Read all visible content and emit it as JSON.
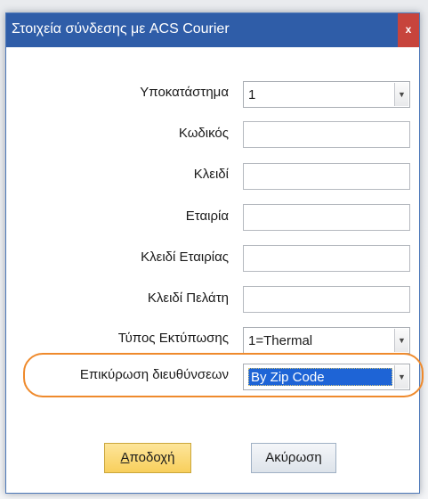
{
  "window": {
    "title": "Στοιχεία σύνδεσης με ACS Courier",
    "close_glyph": "x"
  },
  "form": {
    "branch": {
      "label": "Υποκατάστημα",
      "value": "1"
    },
    "code": {
      "label": "Κωδικός",
      "value": ""
    },
    "key": {
      "label": "Κλειδί",
      "value": ""
    },
    "company": {
      "label": "Εταιρία",
      "value": ""
    },
    "company_key": {
      "label": "Κλειδί Εταιρίας",
      "value": ""
    },
    "customer_key": {
      "label": "Κλειδί Πελάτη",
      "value": ""
    },
    "print_type": {
      "label": "Τύπος Εκτύπωσης",
      "value": "1=Thermal"
    },
    "address_validation": {
      "label": "Επικύρωση διευθύνσεων",
      "value": "By Zip Code"
    }
  },
  "buttons": {
    "accept_label": "Αποδοχή",
    "accept_mnemonic": "Α",
    "accept_rest": "ποδοχή",
    "cancel_label": "Ακύρωση"
  },
  "colors": {
    "titlebar": "#2f5da8",
    "close": "#c7443c",
    "highlight_ring": "#ef8a2c",
    "selection": "#1e64d6",
    "accept_button": "#f8cf5c"
  },
  "icons": {
    "dropdown": "chevron-down-icon",
    "close": "close-icon"
  }
}
